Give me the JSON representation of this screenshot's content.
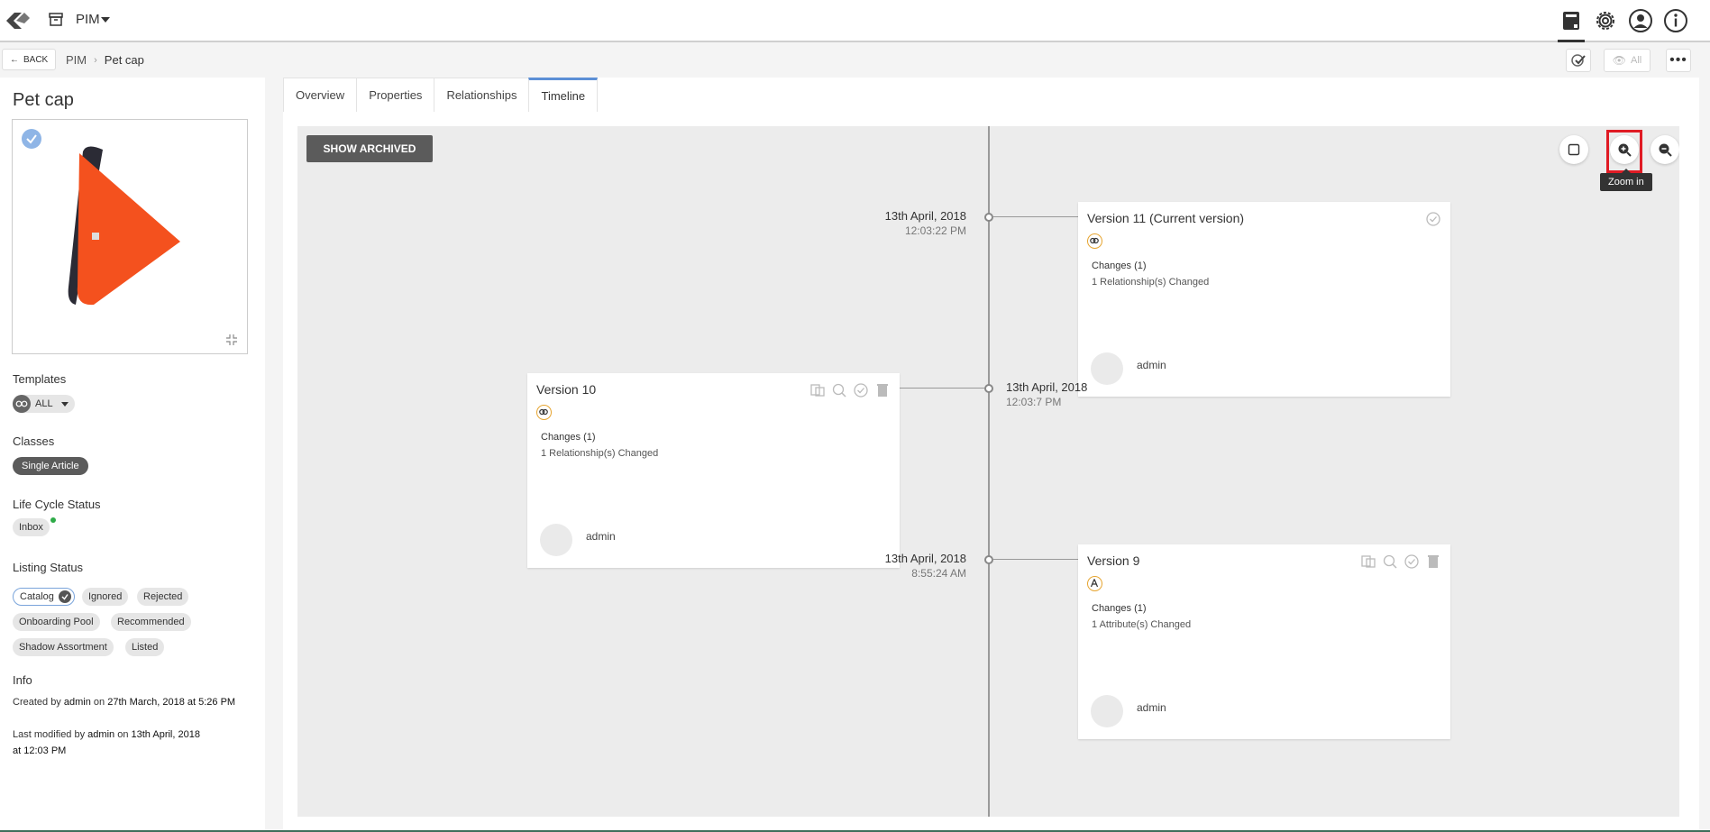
{
  "topbar": {
    "module_name": "PIM"
  },
  "subbar": {
    "back_label": "BACK",
    "breadcrumb": [
      "PIM",
      "Pet cap"
    ],
    "view_label": "All"
  },
  "product": {
    "title": "Pet cap",
    "templates_label": "Templates",
    "templates_value": "ALL",
    "classes_label": "Classes",
    "classes": [
      "Single Article"
    ],
    "lifecycle_label": "Life Cycle Status",
    "lifecycle_value": "Inbox",
    "listing_label": "Listing Status",
    "listing": [
      "Catalog",
      "Ignored",
      "Rejected",
      "Onboarding Pool",
      "Recommended",
      "Shadow Assortment",
      "Listed"
    ],
    "info_label": "Info",
    "info": {
      "created_prefix": "Created by",
      "created_by": "admin",
      "created_on_word": "on",
      "created_date": "27th March, 2018 at 5:26 PM",
      "modified_prefix": "Last modified by",
      "modified_by": "admin",
      "modified_on_word": "on",
      "modified_date": "13th April, 2018 at 12:03 PM"
    }
  },
  "tabs": [
    "Overview",
    "Properties",
    "Relationships",
    "Timeline"
  ],
  "timeline": {
    "show_archived": "SHOW ARCHIVED",
    "zoom_tooltip": "Zoom in",
    "versions": [
      {
        "title": "Version 11 (Current version)",
        "date": "13th April, 2018",
        "time": "12:03:22 PM",
        "changes": "Changes (1)",
        "detail": "1 Relationship(s) Changed",
        "user": "admin"
      },
      {
        "title": "Version 10",
        "date": "13th April, 2018",
        "time": "12:03:7 PM",
        "changes": "Changes (1)",
        "detail": "1 Relationship(s) Changed",
        "user": "admin"
      },
      {
        "title": "Version 9",
        "date": "13th April, 2018",
        "time": "8:55:24 AM",
        "changes": "Changes (1)",
        "detail": "1 Attribute(s) Changed",
        "user": "admin"
      }
    ]
  },
  "colors": {
    "accent": "#5c8fd6",
    "badge": "#e6a531",
    "highlight": "#e01b24",
    "dark_button": "#5b5b5b"
  }
}
